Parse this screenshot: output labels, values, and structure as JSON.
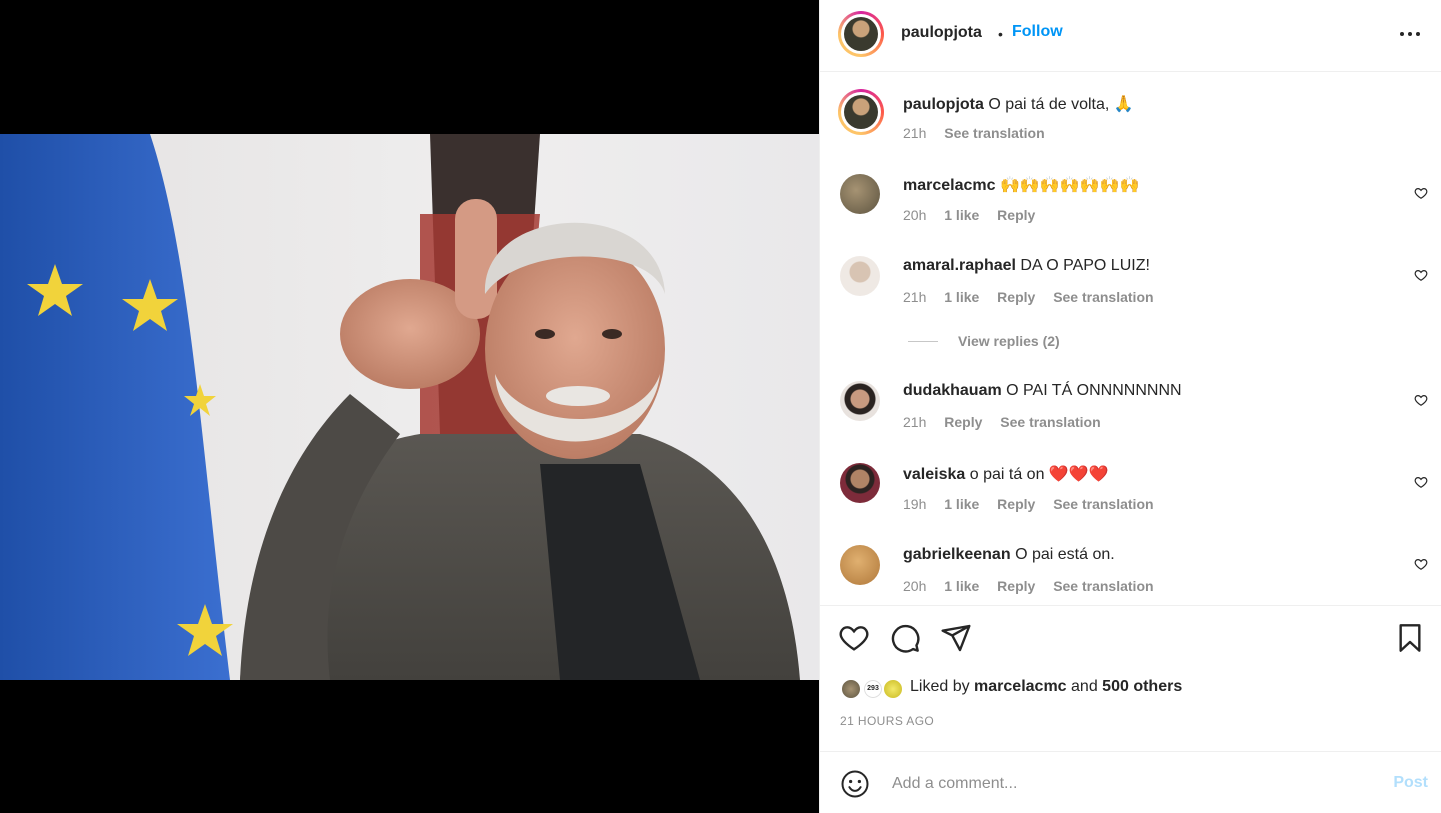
{
  "post": {
    "author": "paulopjota",
    "separator": "•",
    "follow_label": "Follow",
    "caption": "O pai tá de volta, 🙏",
    "caption_time": "21h",
    "caption_translate": "See translation"
  },
  "comments": [
    {
      "user": "marcelacmc",
      "text": "🙌🙌🙌🙌🙌🙌🙌",
      "time": "20h",
      "likes": "1 like",
      "reply": "Reply",
      "translate": ""
    },
    {
      "user": "amaral.raphael",
      "text": "DA O PAPO LUIZ!",
      "time": "21h",
      "likes": "1 like",
      "reply": "Reply",
      "translate": "See translation"
    },
    {
      "user": "dudakhauam",
      "text": "O PAI TÁ ONNNNNNNN",
      "time": "21h",
      "likes": "",
      "reply": "Reply",
      "translate": "See translation"
    },
    {
      "user": "valeiska",
      "text": "o pai tá on ❤️❤️❤️",
      "time": "19h",
      "likes": "1 like",
      "reply": "Reply",
      "translate": "See translation"
    },
    {
      "user": "gabrielkeenan",
      "text": "O pai está on.",
      "time": "20h",
      "likes": "1 like",
      "reply": "Reply",
      "translate": "See translation"
    }
  ],
  "view_replies": "View replies (2)",
  "likes": {
    "prefix": "Liked by",
    "user": "marcelacmc",
    "and": "and",
    "others": "500 others",
    "badge": "293"
  },
  "timestamp": "21 HOURS AGO",
  "add_comment": {
    "placeholder": "Add a comment...",
    "post_label": "Post"
  },
  "colors": {
    "follow": "#0095f6",
    "post_disabled": "#b2dffc",
    "muted": "#8e8e8e"
  },
  "icons": [
    "more-options-icon",
    "heart-icon",
    "comment-icon",
    "share-icon",
    "bookmark-icon",
    "emoji-icon"
  ]
}
